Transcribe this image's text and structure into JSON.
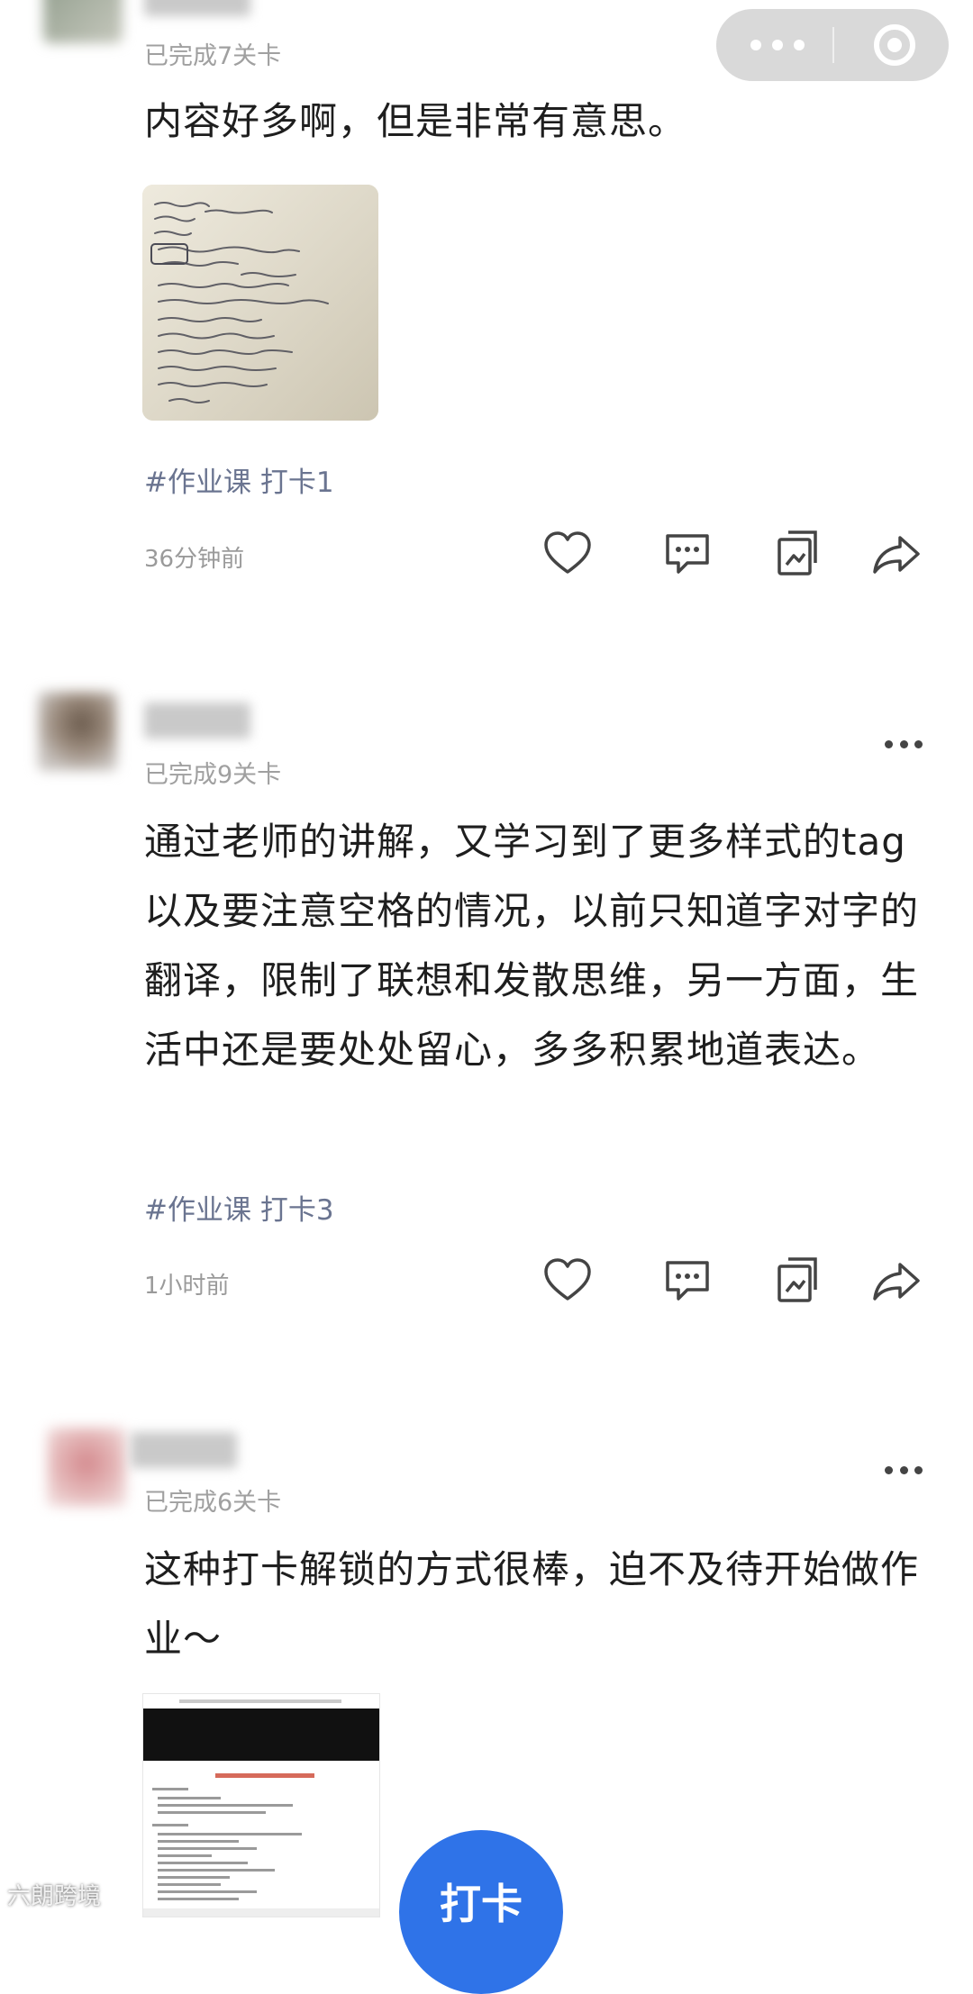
{
  "capsule": {
    "menu_icon": "more-dots-icon",
    "close_icon": "target-circle-icon"
  },
  "icons": {
    "like": "heart-icon",
    "comment": "comment-bubble-icon",
    "share_card": "card-share-icon",
    "forward": "forward-arrow-icon"
  },
  "posts": [
    {
      "progress": "已完成7关卡",
      "content": "内容好多啊，但是非常有意思。",
      "tag": "#作业课 打卡1",
      "time": "36分钟前"
    },
    {
      "progress": "已完成9关卡",
      "content": "通过老师的讲解，又学习到了更多样式的tag以及要注意空格的情况，以前只知道字对字的翻译，限制了联想和发散思维，另一方面，生活中还是要处处留心，多多积累地道表达。",
      "tag": "#作业课 打卡3",
      "time": "1小时前"
    },
    {
      "progress": "已完成6关卡",
      "content": "这种打卡解锁的方式很棒，迫不及待开始做作业～"
    }
  ],
  "fab": {
    "label": "打卡"
  },
  "watermark": "六朗跨境",
  "colors": {
    "accent": "#2f73e8",
    "tag": "#6a7490",
    "meta": "#9a9a9a"
  }
}
